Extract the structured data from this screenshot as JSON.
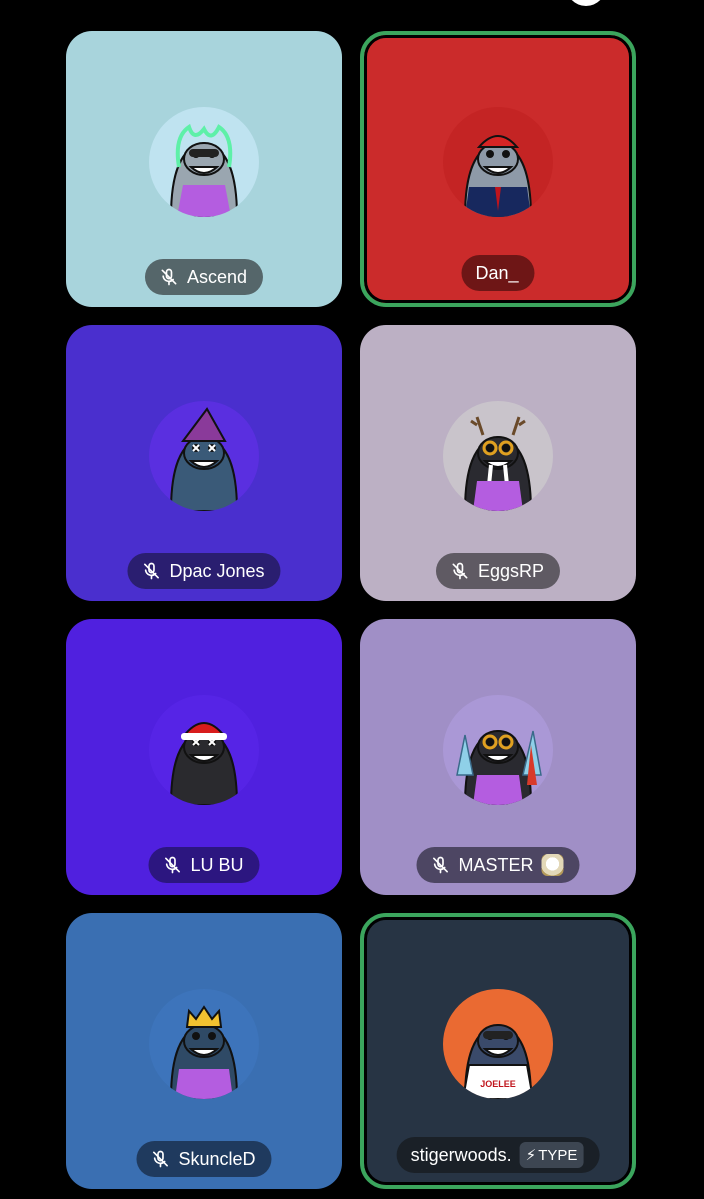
{
  "participants": [
    {
      "name": "Ascend",
      "muted": true,
      "speaking": false,
      "bg": "#a8d4dc",
      "pill_bg": "#55666a",
      "avatar_bg": "#bfe3f0",
      "avatar": "seal-green-flame-sunglasses"
    },
    {
      "name": "Dan_",
      "muted": false,
      "speaking": true,
      "bg": "#cb2b2b",
      "pill_bg": "#6e1616",
      "avatar_bg": "#c42424",
      "avatar": "seal-red-cap-suit"
    },
    {
      "name": "Dpac Jones",
      "muted": true,
      "speaking": false,
      "bg": "#4a2fce",
      "pill_bg": "#2a1e70",
      "avatar_bg": "#5a2fe0",
      "avatar": "seal-wizard-hat"
    },
    {
      "name": "EggsRP",
      "muted": true,
      "speaking": false,
      "bg": "#bcb0c4",
      "pill_bg": "#5f5a63",
      "avatar_bg": "#c9c4cb",
      "avatar": "walrus-antlers-goggles"
    },
    {
      "name": "LU BU",
      "muted": true,
      "speaking": false,
      "bg": "#5020df",
      "pill_bg": "#2c1680",
      "avatar_bg": "#5624e6",
      "avatar": "seal-santa-hat"
    },
    {
      "name": "MASTER",
      "muted": true,
      "speaking": false,
      "bg": "#a08fc6",
      "pill_bg": "#4d4663",
      "avatar_bg": "#aa98d6",
      "avatar": "seal-rocket-crystals",
      "emoji": "badge-emoji"
    },
    {
      "name": "SkuncleD",
      "muted": true,
      "speaking": false,
      "bg": "#3a6fb2",
      "pill_bg": "#1f3a5e",
      "avatar_bg": "#3d74bb",
      "avatar": "seal-gold-crown"
    },
    {
      "name": "stigerwoods.",
      "muted": false,
      "speaking": true,
      "bg": "#273444",
      "pill_bg": "#1a2027",
      "avatar_bg": "#ea6a32",
      "avatar": "seal-joelee-shirt",
      "badge": "TYPE",
      "badge_icon": "lightning-icon"
    }
  ],
  "colors": {
    "speaking_ring": "#3ba55d",
    "page_bg": "#000000",
    "pill_text": "#ffffff"
  },
  "icons": {
    "mute": "mic-muted-icon"
  }
}
